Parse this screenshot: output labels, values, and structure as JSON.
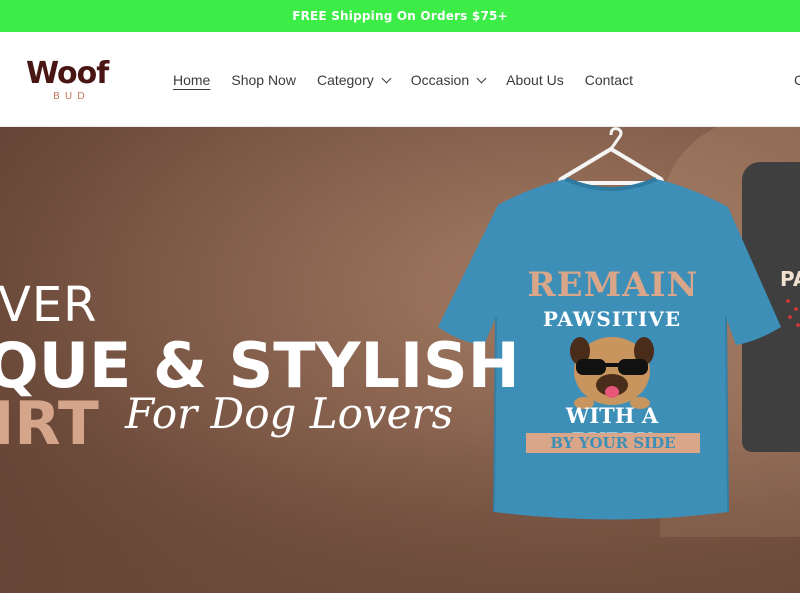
{
  "announcement": {
    "text": "FREE Shipping On Orders $75+"
  },
  "brand": {
    "name": "Woof",
    "sub": "BUD"
  },
  "nav": {
    "items": [
      {
        "label": "Home",
        "active": true,
        "dropdown": false
      },
      {
        "label": "Shop Now",
        "active": false,
        "dropdown": false
      },
      {
        "label": "Category",
        "active": false,
        "dropdown": true
      },
      {
        "label": "Occasion",
        "active": false,
        "dropdown": true
      },
      {
        "label": "About Us",
        "active": false,
        "dropdown": false
      },
      {
        "label": "Contact",
        "active": false,
        "dropdown": false
      }
    ],
    "edge_glyph": "C"
  },
  "hero": {
    "line1": "VER",
    "line2": "QUE & STYLISH",
    "line3": "IRT",
    "script": "For Dog Lovers",
    "shirt_text": [
      "REMAIN",
      "PAWSITIVE",
      "WITH A PUPPY",
      "BY YOUR SIDE"
    ],
    "second_shirt_text": "PA"
  },
  "colors": {
    "announcement_bg": "#3ded47",
    "brand_primary": "#4a1614",
    "brand_accent": "#c27a5e",
    "shirt_blue": "#3d8fb8",
    "shirt_accent": "#d9a68a"
  }
}
